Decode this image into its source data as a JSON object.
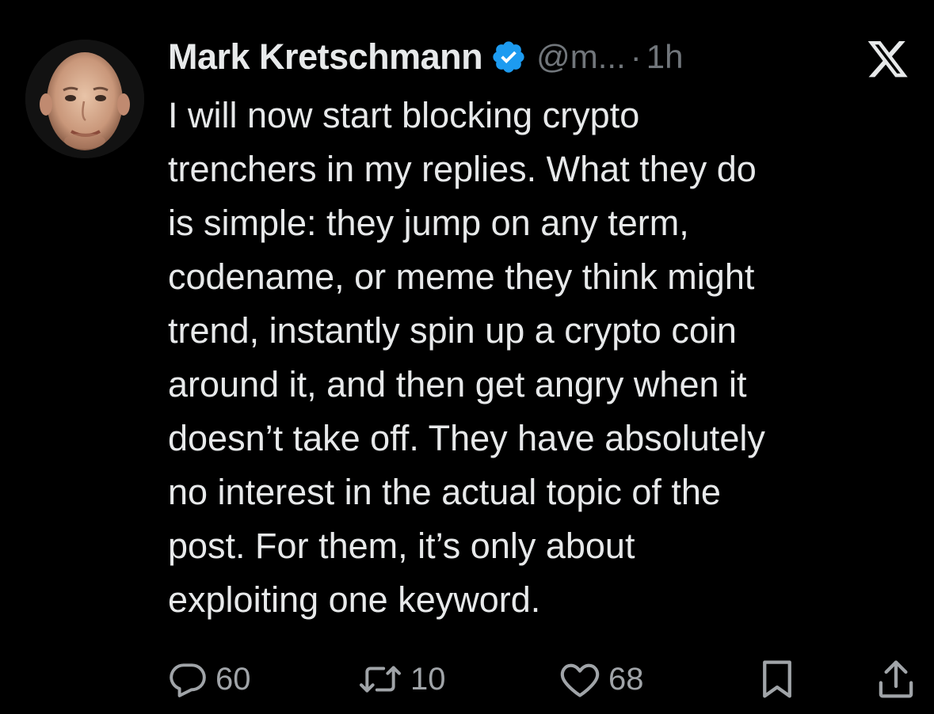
{
  "author": {
    "name": "Mark Kretschmann",
    "handle": "@m...",
    "separator": "·",
    "time": "1h",
    "verified": true
  },
  "post": {
    "text": "I will now start blocking crypto\ntrenchers in my replies. What they do\nis simple: they jump on any term,\ncodename, or meme they think might\ntrend, instantly spin up a crypto coin\naround it, and then get angry when it\ndoesn’t take off. They have absolutely\nno interest in the actual topic of the\npost. For them, it’s only about\nexploiting one keyword."
  },
  "actions": {
    "replies": "60",
    "reposts": "10",
    "likes": "68"
  },
  "icons": {
    "verified": "verified-badge-icon",
    "platform": "x-logo-icon",
    "reply": "reply-bubble-icon",
    "repost": "repost-arrows-icon",
    "like": "heart-icon",
    "bookmark": "bookmark-icon",
    "share": "share-upload-icon"
  },
  "colors": {
    "background": "#000000",
    "text": "#e7e9ea",
    "secondary": "#71767b",
    "verified": "#1d9bf0"
  }
}
